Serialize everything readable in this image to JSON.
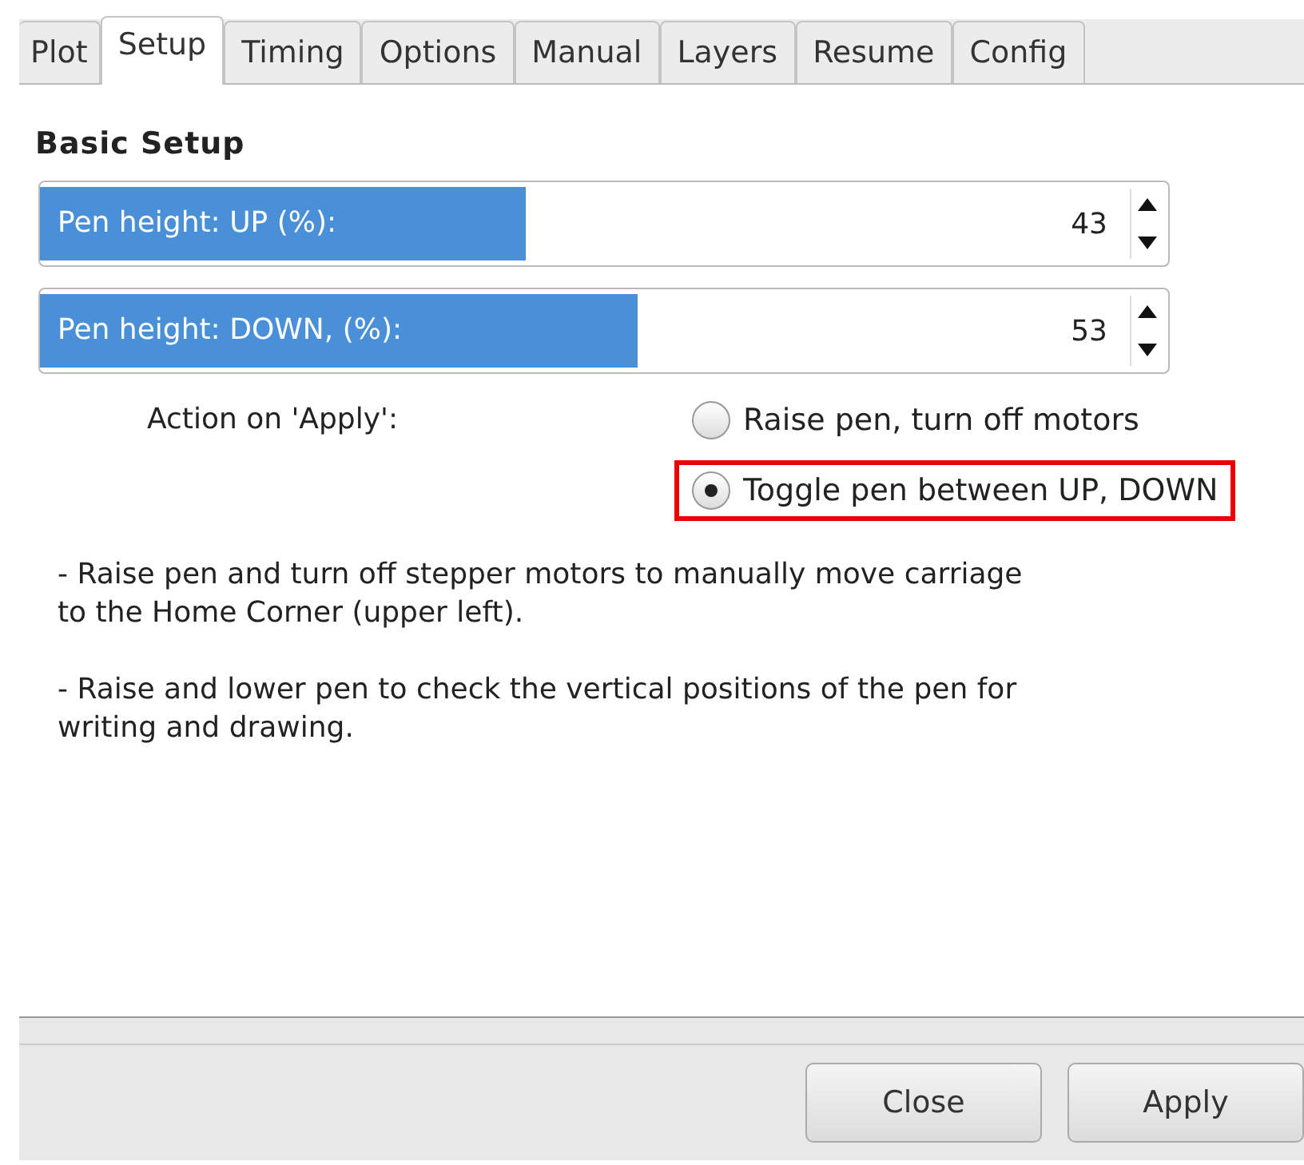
{
  "tabs": [
    {
      "label": "Plot",
      "selected": false
    },
    {
      "label": "Setup",
      "selected": true
    },
    {
      "label": "Timing",
      "selected": false
    },
    {
      "label": "Options",
      "selected": false
    },
    {
      "label": "Manual",
      "selected": false
    },
    {
      "label": "Layers",
      "selected": false
    },
    {
      "label": "Resume",
      "selected": false
    },
    {
      "label": "Config",
      "selected": false
    }
  ],
  "section_title": "Basic Setup",
  "sliders": [
    {
      "label": "Pen height: UP (%):",
      "value": "43",
      "level": 0.43
    },
    {
      "label": "Pen height: DOWN, (%):",
      "value": "53",
      "level": 0.53
    }
  ],
  "action": {
    "label": "Action on 'Apply':",
    "options": [
      {
        "label": "Raise pen, turn off motors",
        "selected": false,
        "highlighted": false
      },
      {
        "label": "Toggle pen between UP, DOWN",
        "selected": true,
        "highlighted": true
      }
    ]
  },
  "notes": [
    "- Raise pen and turn off stepper motors to manually move carriage to the Home Corner (upper left).",
    "- Raise and lower pen to check the vertical positions of the pen for writing and drawing."
  ],
  "buttons": [
    "Close",
    "Apply"
  ]
}
